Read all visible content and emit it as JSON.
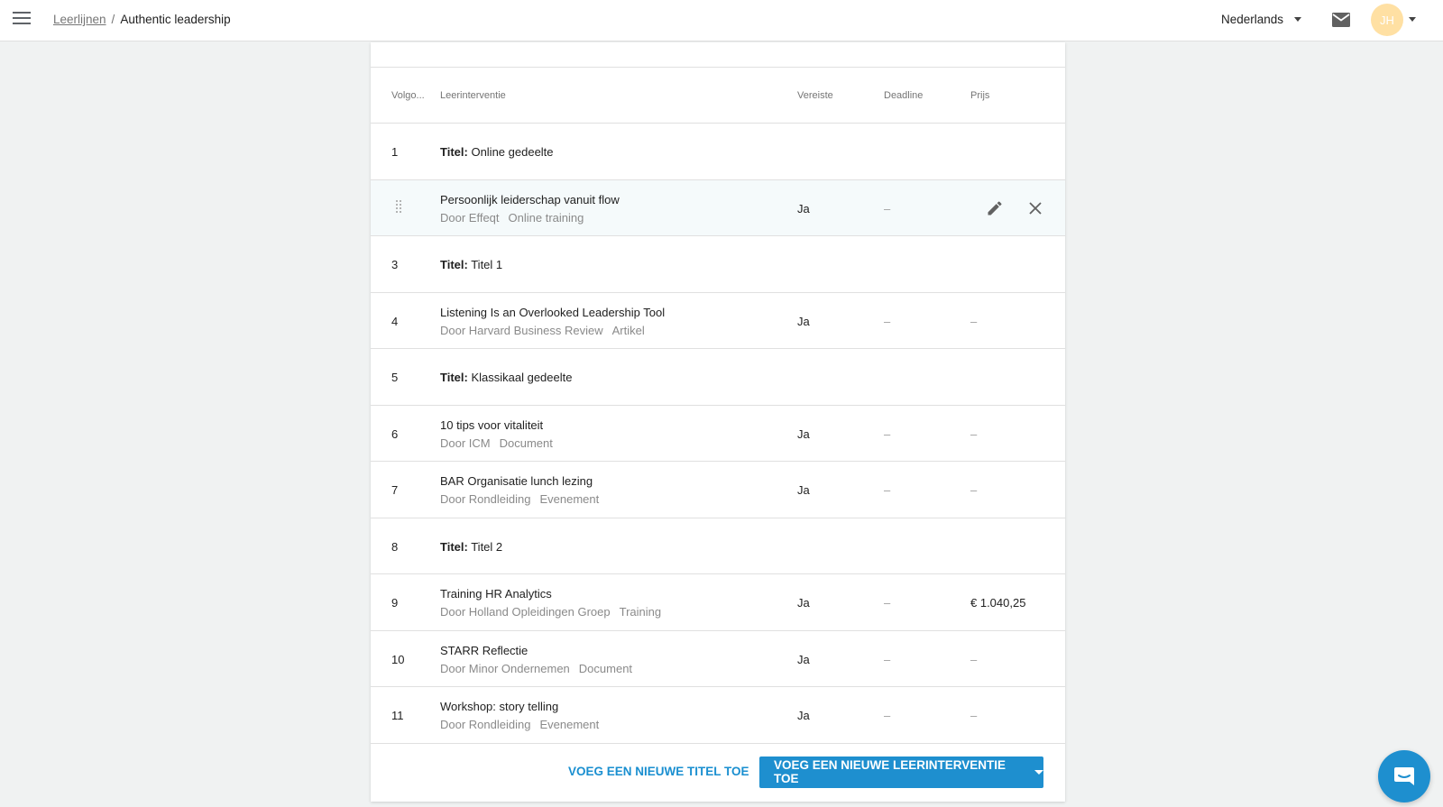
{
  "header": {
    "breadcrumb_link": "Leerlijnen",
    "breadcrumb_sep": "/",
    "breadcrumb_current": "Authentic leadership",
    "language": "Nederlands",
    "avatar_initials": "JH"
  },
  "table": {
    "columns": {
      "order": "Volgo...",
      "intervention": "Leerinterventie",
      "required": "Vereiste",
      "deadline": "Deadline",
      "price": "Prijs"
    },
    "title_prefix": "Titel:",
    "rows": [
      {
        "num": "1",
        "title": "Online gedeelte"
      },
      {
        "title": "Persoonlijk leiderschap vanuit flow",
        "by": "Door Effeqt",
        "type": "Online training",
        "required": "Ja",
        "deadline": "–"
      },
      {
        "num": "3",
        "title": "Titel 1"
      },
      {
        "num": "4",
        "title": "Listening Is an Overlooked Leadership Tool",
        "by": "Door Harvard Business Review",
        "type": "Artikel",
        "required": "Ja",
        "deadline": "–",
        "price": "–"
      },
      {
        "num": "5",
        "title": "Klassikaal gedeelte"
      },
      {
        "num": "6",
        "title": "10 tips voor vitaliteit",
        "by": "Door ICM",
        "type": "Document",
        "required": "Ja",
        "deadline": "–",
        "price": "–"
      },
      {
        "num": "7",
        "title": "BAR Organisatie lunch lezing",
        "by": "Door Rondleiding",
        "type": "Evenement",
        "required": "Ja",
        "deadline": "–",
        "price": "–"
      },
      {
        "num": "8",
        "title": "Titel 2"
      },
      {
        "num": "9",
        "title": "Training HR Analytics",
        "by": "Door Holland Opleidingen Groep",
        "type": "Training",
        "required": "Ja",
        "deadline": "–",
        "price": "€ 1.040,25"
      },
      {
        "num": "10",
        "title": "STARR Reflectie",
        "by": "Door Minor Ondernemen",
        "type": "Document",
        "required": "Ja",
        "deadline": "–",
        "price": "–"
      },
      {
        "num": "11",
        "title": "Workshop: story telling",
        "by": "Door Rondleiding",
        "type": "Evenement",
        "required": "Ja",
        "deadline": "–",
        "price": "–"
      }
    ]
  },
  "footer": {
    "add_title_label": "VOEG EEN NIEUWE TITEL TOE",
    "add_intervention_label": "VOEG EEN NIEUWE LEERINTERVENTIE TOE"
  },
  "colors": {
    "accent": "#1e8fcf",
    "avatar_bg": "#ffe0a3",
    "page_bg": "#f0f2f2"
  }
}
